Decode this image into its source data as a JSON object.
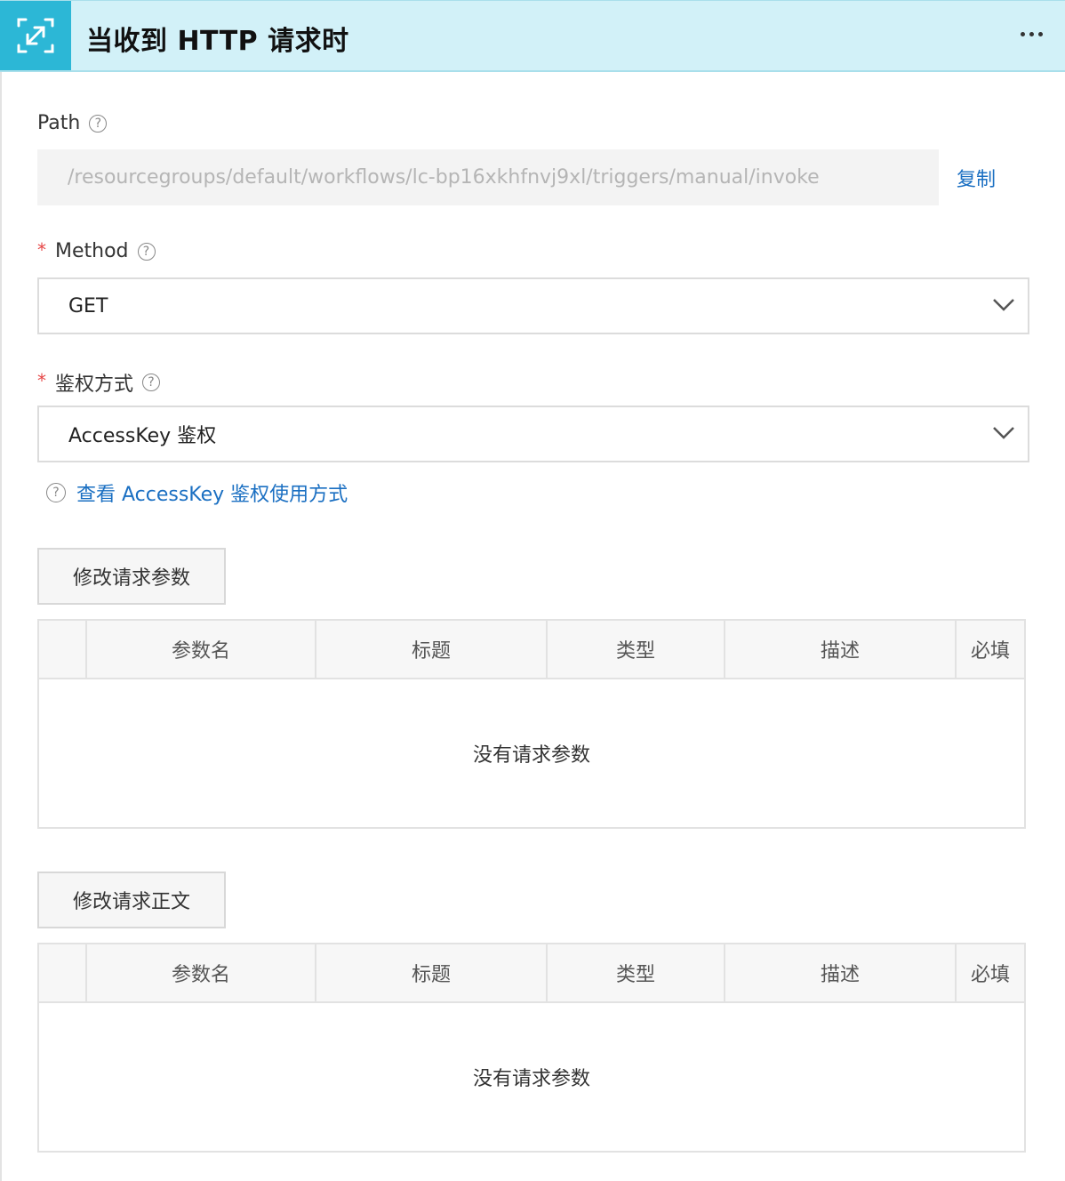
{
  "header": {
    "title": "当收到 HTTP 请求时",
    "icon": "http-trigger-icon",
    "more": "more-icon"
  },
  "path": {
    "label": "Path",
    "value": "/resourcegroups/default/workflows/lc-bp16xkhfnvj9xl/triggers/manual/invoke",
    "copy": "复制"
  },
  "method": {
    "required": "*",
    "label": "Method",
    "value": "GET"
  },
  "auth": {
    "required": "*",
    "label": "鉴权方式",
    "value": "AccessKey 鉴权",
    "hint": "查看 AccessKey 鉴权使用方式"
  },
  "params": {
    "button": "修改请求参数",
    "columns": [
      "参数名",
      "标题",
      "类型",
      "描述",
      "必填"
    ],
    "empty": "没有请求参数"
  },
  "body": {
    "button": "修改请求正文",
    "columns": [
      "参数名",
      "标题",
      "类型",
      "描述",
      "必填"
    ],
    "empty": "没有请求参数"
  },
  "colors": {
    "header_bg": "#d2f1f8",
    "icon_bg": "#2cb7d6",
    "link": "#1a6fc2",
    "required": "#e64545"
  }
}
